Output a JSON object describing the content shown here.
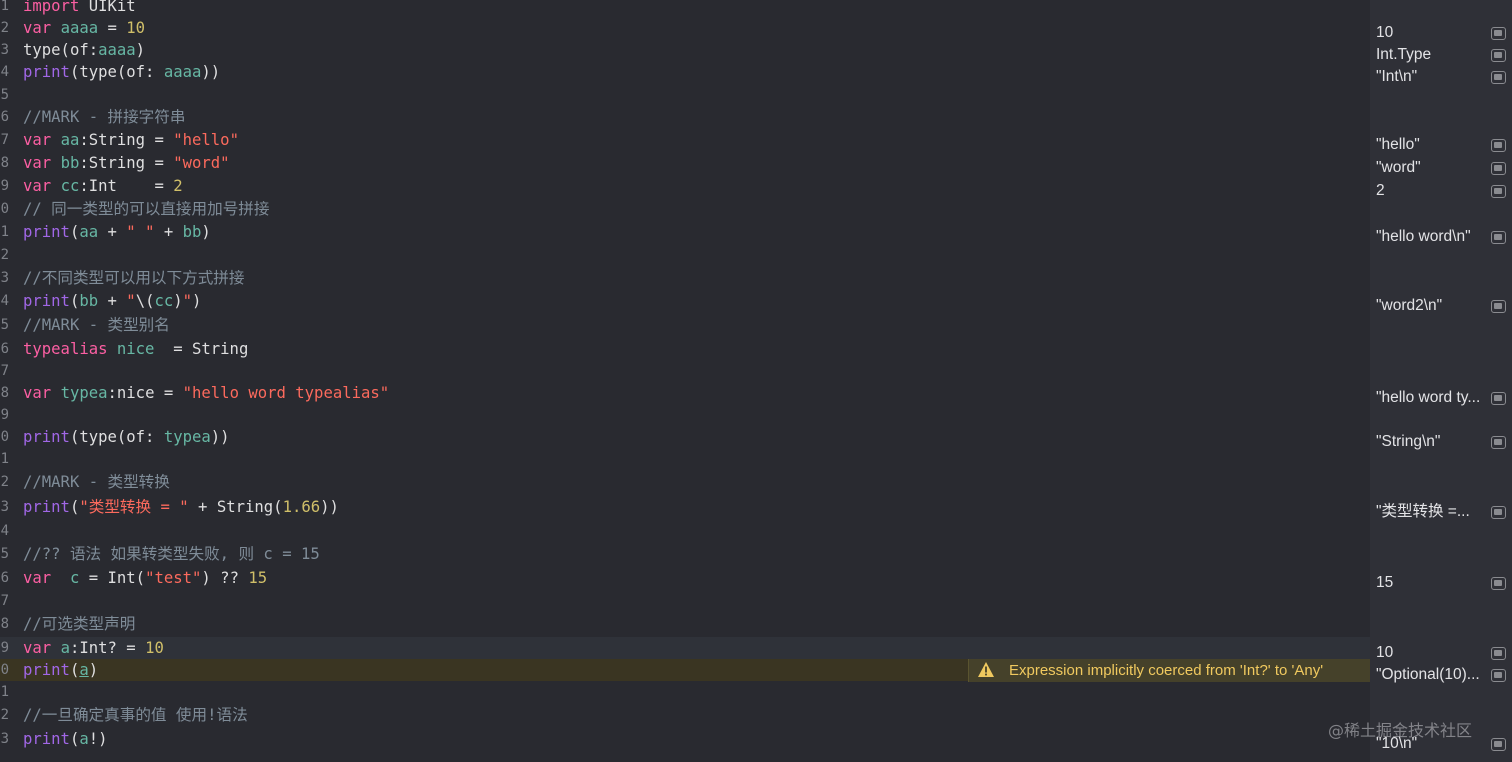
{
  "editor": {
    "lines": [
      {
        "ln": "1",
        "code": "<span class='kw'>import</span> <span class='plain'>UIKit</span>"
      },
      {
        "ln": "2",
        "code": "<span class='kw'>var</span> <span class='var'>aaaa</span> = <span class='num'>10</span>"
      },
      {
        "ln": "3",
        "code": "<span class='plain'>type(of:</span><span class='var'>aaaa</span><span class='plain'>)</span>"
      },
      {
        "ln": "4",
        "code": "<span class='fn'>print</span>(type(of: <span class='var'>aaaa</span>))"
      },
      {
        "ln": "5",
        "code": ""
      },
      {
        "ln": "6",
        "code": "<span class='cmt'>//MARK - 拼接字符串</span>"
      },
      {
        "ln": "7",
        "code": "<span class='kw'>var</span> <span class='var'>aa</span>:String = <span class='str'>\"hello\"</span>"
      },
      {
        "ln": "8",
        "code": "<span class='kw'>var</span> <span class='var'>bb</span>:String = <span class='str'>\"word\"</span>"
      },
      {
        "ln": "9",
        "code": "<span class='kw'>var</span> <span class='var'>cc</span>:Int    = <span class='num'>2</span>"
      },
      {
        "ln": "0",
        "code": "<span class='cmt'>// 同一类型的可以直接用加号拼接</span>"
      },
      {
        "ln": "1",
        "code": "<span class='fn'>print</span>(<span class='var'>aa</span> + <span class='str'>\" \"</span> + <span class='var'>bb</span>)"
      },
      {
        "ln": "2",
        "code": ""
      },
      {
        "ln": "3",
        "code": "<span class='cmt'>//不同类型可以用以下方式拼接</span>"
      },
      {
        "ln": "4",
        "code": "<span class='fn'>print</span>(<span class='var'>bb</span> + <span class='str'>\"</span>\\(<span class='var'>cc</span>)<span class='str'>\"</span>)"
      },
      {
        "ln": "5",
        "code": "<span class='cmt'>//MARK - 类型别名</span>"
      },
      {
        "ln": "6",
        "code": "<span class='kw'>typealias</span> <span class='var'>nice</span>  = String"
      },
      {
        "ln": "7",
        "code": ""
      },
      {
        "ln": "8",
        "code": "<span class='kw'>var</span> <span class='var'>typea</span>:nice = <span class='str'>\"hello word typealias\"</span>"
      },
      {
        "ln": "9",
        "code": ""
      },
      {
        "ln": "0",
        "code": "<span class='fn'>print</span>(type(of: <span class='var'>typea</span>))"
      },
      {
        "ln": "1",
        "code": ""
      },
      {
        "ln": "2",
        "code": "<span class='cmt'>//MARK - 类型转换</span>"
      },
      {
        "ln": "3",
        "code": "<span class='fn'>print</span>(<span class='str'>\"类型转换 = \"</span> + String(<span class='num'>1.66</span>))"
      },
      {
        "ln": "4",
        "code": ""
      },
      {
        "ln": "5",
        "code": "<span class='cmt'>//?? 语法 如果转类型失败, 则 c = 15</span>"
      },
      {
        "ln": "6",
        "code": "<span class='kw'>var</span>  <span class='var'>c</span> = Int(<span class='str'>\"test\"</span>) ?? <span class='num'>15</span>"
      },
      {
        "ln": "7",
        "code": ""
      },
      {
        "ln": "8",
        "code": "<span class='cmt'>//可选类型声明</span>"
      },
      {
        "ln": "9",
        "code": "<span class='kw'>var</span> <span class='var'>a</span>:Int? = <span class='num'>10</span>"
      },
      {
        "ln": "0",
        "code": "<span class='fn'>print</span>(<span class='var ul'>a</span>)"
      },
      {
        "ln": "1",
        "code": ""
      },
      {
        "ln": "2",
        "code": "<span class='cmt'>//一旦确定真事的值 使用!语法</span>"
      },
      {
        "ln": "3",
        "code": "<span class='fn'>print</span>(<span class='var'>a</span>!)"
      }
    ]
  },
  "warning": {
    "text": "Expression implicitly coerced from 'Int?' to 'Any'"
  },
  "results": [
    {
      "line": 2,
      "text": "10"
    },
    {
      "line": 3,
      "text": "Int.Type"
    },
    {
      "line": 4,
      "text": "\"Int\\n\""
    },
    {
      "line": 7,
      "text": "\"hello\""
    },
    {
      "line": 8,
      "text": "\"word\""
    },
    {
      "line": 9,
      "text": "2"
    },
    {
      "line": 11,
      "text": "\"hello word\\n\""
    },
    {
      "line": 14,
      "text": "\"word2\\n\""
    },
    {
      "line": 18,
      "text": "\"hello word ty..."
    },
    {
      "line": 20,
      "text": "\"String\\n\""
    },
    {
      "line": 23,
      "text": "\"类型转换 =..."
    },
    {
      "line": 26,
      "text": "15"
    },
    {
      "line": 29,
      "text": "10"
    },
    {
      "line": 30,
      "text": "\"Optional(10)..."
    },
    {
      "line": 33,
      "text": "\"10\\n\""
    }
  ],
  "watermark": "@稀土掘金技术社区",
  "colors": {
    "editor_bg": "#292a30",
    "keyword": "#fc5fa3",
    "string": "#fc6a5d",
    "number": "#d0bf69",
    "comment": "#7f8c98",
    "warning": "#f0c95f"
  }
}
